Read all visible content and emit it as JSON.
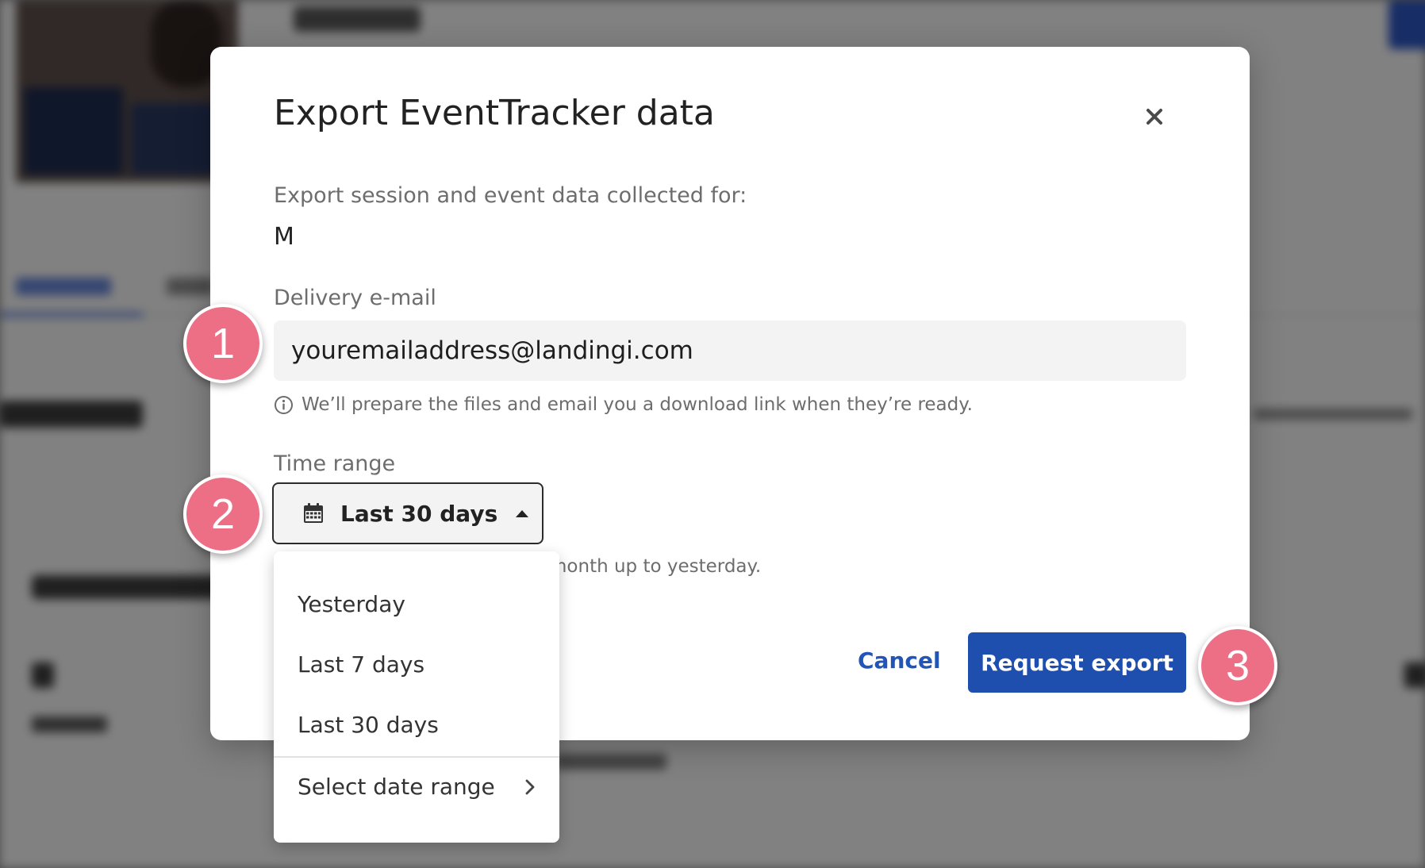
{
  "dialog": {
    "title": "Export EventTracker data",
    "close_icon": "close-icon",
    "subject_label": "Export session and event data collected for:",
    "subject_value": "M",
    "email": {
      "label": "Delivery e-mail",
      "value": "youremailaddress@landingi.com",
      "hint": "We’ll prepare the files and email you a download link when they’re ready."
    },
    "time_range": {
      "label": "Time range",
      "selected": "Last 30 days",
      "hint": "the beginning of the previous month up to yesterday.",
      "options": [
        "Yesterday",
        "Last 7 days",
        "Last 30 days"
      ],
      "custom_option": "Select date range"
    },
    "actions": {
      "cancel_label": "Cancel",
      "request_label": "Request export"
    }
  },
  "steps": [
    "1",
    "2",
    "3"
  ],
  "colors": {
    "primary": "#1e4fae",
    "link": "#2155b8",
    "step_badge": "#ec6f86",
    "overlay": "#8b8b8b"
  }
}
